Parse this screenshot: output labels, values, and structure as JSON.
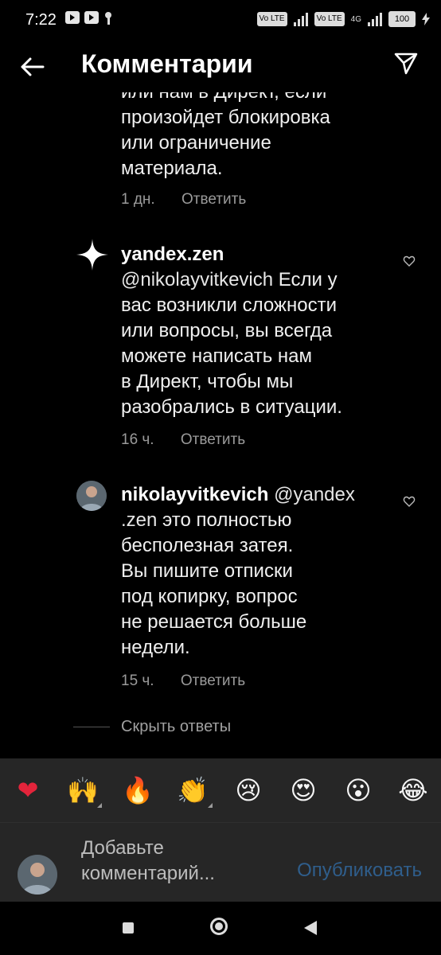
{
  "status": {
    "time": "7:22",
    "lte1": "Vo LTE",
    "lte2": "Vo LTE",
    "net": "4G",
    "battery": "100"
  },
  "header": {
    "title": "Комментарии"
  },
  "comment0": {
    "lines": [
      "или нам в Директ, если",
      "произойдет блокировка",
      "или ограничение",
      "материала."
    ],
    "time": "1 дн.",
    "reply": "Ответить"
  },
  "comment1": {
    "username": "yandex.zen",
    "mention": "@nikolayvitkevich",
    "line1_rest": " Если у",
    "lines": [
      "вас возникли сложности",
      "или вопросы, вы всегда",
      "можете написать нам",
      "в Директ, чтобы мы",
      "разобрались в ситуации."
    ],
    "time": "16 ч.",
    "reply": "Ответить"
  },
  "comment2": {
    "username": "nikolayvitkevich",
    "mention_a": "@yandex",
    "mention_b": ".zen",
    "line2_rest": " это полностью",
    "lines": [
      "бесполезная затея.",
      "Вы пишите отписки",
      "под копирку, вопрос",
      "не решается больше",
      "недели."
    ],
    "time": "15 ч.",
    "reply": "Ответить"
  },
  "hide_replies": "Скрыть ответы",
  "emoji_bar": [
    {
      "glyph": "❤",
      "name": "red-heart"
    },
    {
      "glyph": "🙌",
      "name": "raising-hands"
    },
    {
      "glyph": "🔥",
      "name": "fire"
    },
    {
      "glyph": "👏",
      "name": "clapping-hands"
    },
    {
      "glyph": "😢",
      "name": "crying-face"
    },
    {
      "glyph": "😍",
      "name": "heart-eyes"
    },
    {
      "glyph": "😮",
      "name": "surprised-face"
    },
    {
      "glyph": "😂",
      "name": "tears-of-joy"
    }
  ],
  "composer": {
    "placeholder": "Добавьте комментарий...",
    "publish": "Опубликовать"
  },
  "colors": {
    "background": "#000000",
    "panel": "#262626",
    "muted": "#9a9a9a",
    "publish": "#2f5e8c"
  }
}
